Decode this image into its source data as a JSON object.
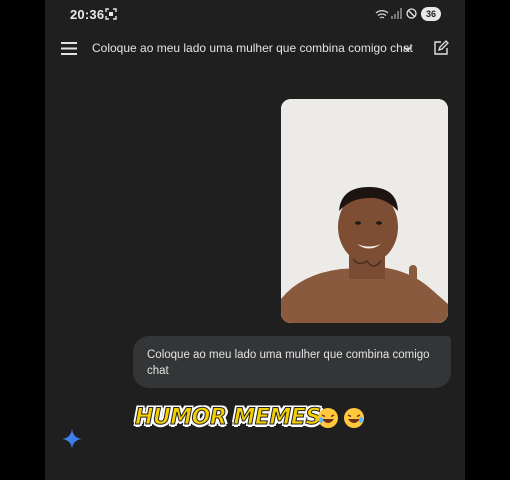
{
  "status_bar": {
    "time": "20:36",
    "battery": "36",
    "icons": [
      "screenshot-icon",
      "wifi-icon",
      "signal-icon",
      "do-not-disturb-icon",
      "battery-icon"
    ]
  },
  "app_bar": {
    "title": "Coloque ao meu lado uma mulher que combina comigo chat",
    "icons": [
      "menu-icon",
      "chevron-down-icon",
      "edit-icon"
    ]
  },
  "message": {
    "text": "Coloque ao meu lado uma mulher que combina comigo chat"
  },
  "overlay": {
    "caption": "HUMOR MEMES",
    "emoji_count": 2
  },
  "colors": {
    "background": "#1f1f20",
    "bubble": "#333537",
    "text": "#e3e3e3",
    "accent": "#4285f4",
    "meme_yellow": "#f5d000"
  }
}
